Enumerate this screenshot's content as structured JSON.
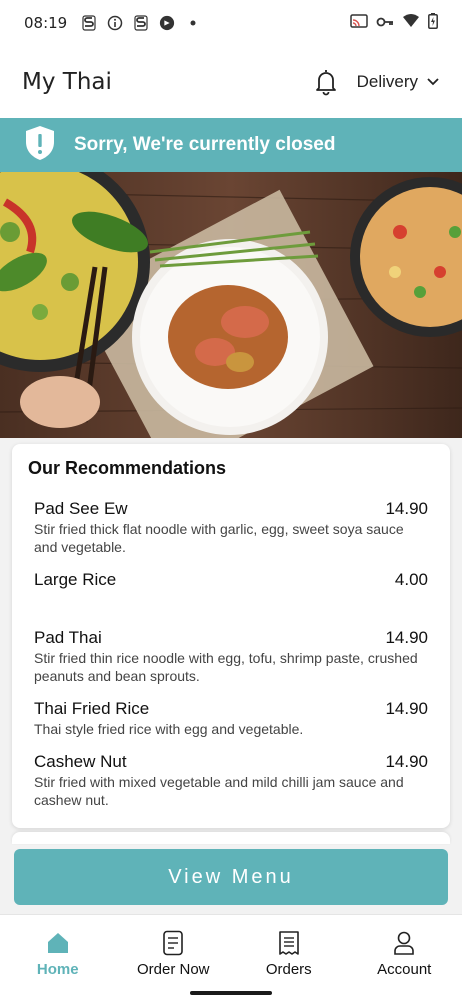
{
  "status_bar": {
    "time": "08:19",
    "icons": [
      "signal-s-icon",
      "info-icon",
      "signal-s-icon",
      "app-icon",
      "dot-icon"
    ],
    "right_icons": [
      "cast-icon",
      "vpn-key-icon",
      "wifi-icon",
      "battery-icon"
    ]
  },
  "header": {
    "title": "My Thai",
    "bell_icon": "bell-icon",
    "delivery_label": "Delivery"
  },
  "banner": {
    "text": "Sorry, We're currently closed",
    "icon": "shield-alert-icon"
  },
  "recommendations": {
    "title": "Our Recommendations",
    "items": [
      {
        "name": "Pad See Ew",
        "price": "14.90",
        "desc": "Stir fried thick flat noodle with garlic, egg, sweet soya sauce and vegetable."
      },
      {
        "name": "Large Rice",
        "price": "4.00",
        "desc": ""
      },
      {
        "name": "Pad Thai",
        "price": "14.90",
        "desc": "Stir fried thin rice noodle with egg, tofu, shrimp paste, crushed peanuts and bean sprouts."
      },
      {
        "name": "Thai Fried Rice",
        "price": "14.90",
        "desc": "Thai style fried rice with egg and vegetable."
      },
      {
        "name": "Cashew Nut",
        "price": "14.90",
        "desc": "Stir fried with mixed vegetable and mild chilli jam sauce and cashew nut."
      }
    ]
  },
  "view_menu_label": "View Menu",
  "nav": {
    "items": [
      {
        "label": "Home",
        "icon": "home-icon",
        "active": true
      },
      {
        "label": "Order Now",
        "icon": "order-icon",
        "active": false
      },
      {
        "label": "Orders",
        "icon": "receipt-icon",
        "active": false
      },
      {
        "label": "Account",
        "icon": "person-icon",
        "active": false
      }
    ]
  },
  "colors": {
    "accent": "#5fb3b8",
    "background": "#f2f2f2"
  }
}
